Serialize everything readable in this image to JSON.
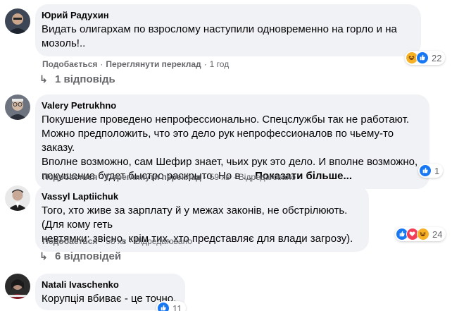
{
  "comments": [
    {
      "author": "Юрий Радухин",
      "text": "Видать олигархам по взрослому наступили одновременно на горло и на\nмозоль!..",
      "like": "Подобається",
      "translate": "Переглянути переклад",
      "time": "1 год",
      "reaction_count": "22",
      "replies": "1 відповідь"
    },
    {
      "author": "Valery Petrukhno",
      "text": "Покушение проведено непрофессионально. Спецслужбы так не работают.\nМожно предположить, что это дело рук непрофессионалов по чьему-то заказу.\nВполне возможно, сам Шефир знает, чьих рук это дело. И вполне возможно,\nпокушение будет быстро раскрыто. Но в ... ",
      "see_more": "Показати більше...",
      "like": "Подобається",
      "translate": "Переглянути переклад",
      "time": "59 хв",
      "edited": "Відредаговано",
      "reaction_count": "1"
    },
    {
      "author": "Vassyl Laptiichuk",
      "text": "Того, хто живе за зарплату й у межах законів, не обстрілюють. (Для кому геть\nневтямки: звісно, крім тих, хто представляє для влади загрозу).",
      "like": "Подобається",
      "time": "58 хв",
      "edited": "Відредаговано",
      "reaction_count": "24",
      "replies": "6 відповідей"
    },
    {
      "author": "Natali Ivaschenko",
      "text": "Корупція вбиває - це точно.",
      "reaction_count": "11"
    }
  ],
  "separator": "·",
  "colors": {
    "like_blue": "#1877f2",
    "love_red": "#f33e58",
    "haha_yellow": "#f7b125",
    "bubble_bg": "#f0f2f5",
    "secondary_text": "#65676b"
  },
  "icons": {
    "reply_arrow": "reply-arrow-icon",
    "like": "like-reaction-icon",
    "love": "love-reaction-icon",
    "haha": "haha-reaction-icon"
  }
}
